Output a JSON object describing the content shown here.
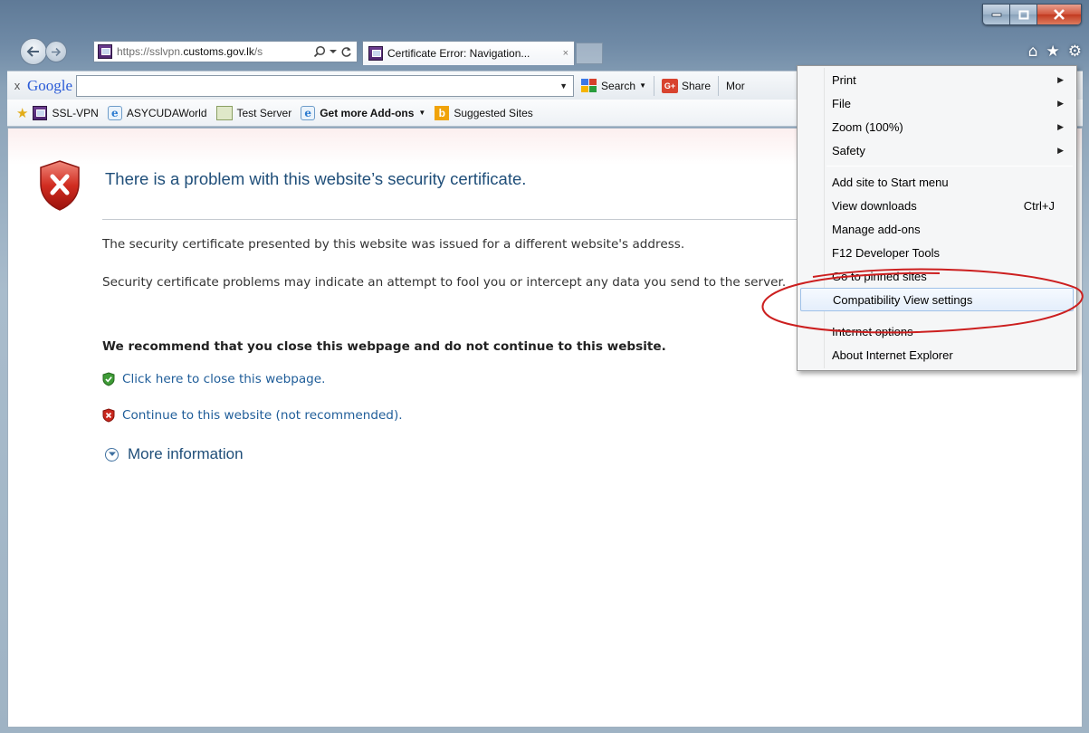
{
  "window": {
    "minimize_label": "–",
    "maximize_label": "□",
    "close_label": "X"
  },
  "addressbar": {
    "url_prefix": "https://sslvpn.",
    "url_domain": "customs.gov.lk",
    "url_suffix": "/s",
    "search_icon": "search-icon",
    "refresh_icon": "refresh-icon"
  },
  "tab": {
    "title": "Certificate Error: Navigation...",
    "close_label": "×"
  },
  "right_icons": [
    "home-icon",
    "favorites-star-icon",
    "tools-gear-icon"
  ],
  "google_toolbar": {
    "close_label": "x",
    "logo": "Google",
    "search_label": "Search",
    "share_label": "Share",
    "more_label": "Mor"
  },
  "favorites": {
    "items": [
      {
        "label": "SSL-VPN",
        "icon": "sslvpn-favicon"
      },
      {
        "label": "ASYCUDAWorld",
        "icon": "ie-page-icon"
      },
      {
        "label": "Test Server",
        "icon": "test-server-icon"
      },
      {
        "label": "Get more Add-ons",
        "icon": "ie-page-icon",
        "dropdown": true
      },
      {
        "label": "Suggested Sites",
        "icon": "bing-icon"
      }
    ]
  },
  "error_page": {
    "title": "There is a problem with this website’s security certificate.",
    "para1": "The security certificate presented by this website was issued for a different website's address.",
    "para2": "Security certificate problems may indicate an attempt to fool you or intercept any data you send to the server.",
    "recommend": "We recommend that you close this webpage and do not continue to this website.",
    "close_link": "Click here to close this webpage.",
    "continue_link": "Continue to this website (not recommended).",
    "more_info": "More information"
  },
  "tools_menu": {
    "items": [
      {
        "label": "Print",
        "submenu": true
      },
      {
        "label": "File",
        "submenu": true
      },
      {
        "label": "Zoom (100%)",
        "submenu": true
      },
      {
        "label": "Safety",
        "submenu": true
      },
      {
        "label": "Add site to Start menu"
      },
      {
        "label": "View downloads",
        "shortcut": "Ctrl+J"
      },
      {
        "label": "Manage add-ons"
      },
      {
        "label": "F12 Developer Tools"
      },
      {
        "label": "Go to pinned sites"
      },
      {
        "label": "Compatibility View settings",
        "highlighted": true
      },
      {
        "label": "Internet options"
      },
      {
        "label": "About Internet Explorer"
      }
    ]
  },
  "colors": {
    "link": "#1f5d99",
    "title": "#1f4e79",
    "annotation_red": "#cc1f1f",
    "menu_highlight_border": "#9fc1e8"
  }
}
